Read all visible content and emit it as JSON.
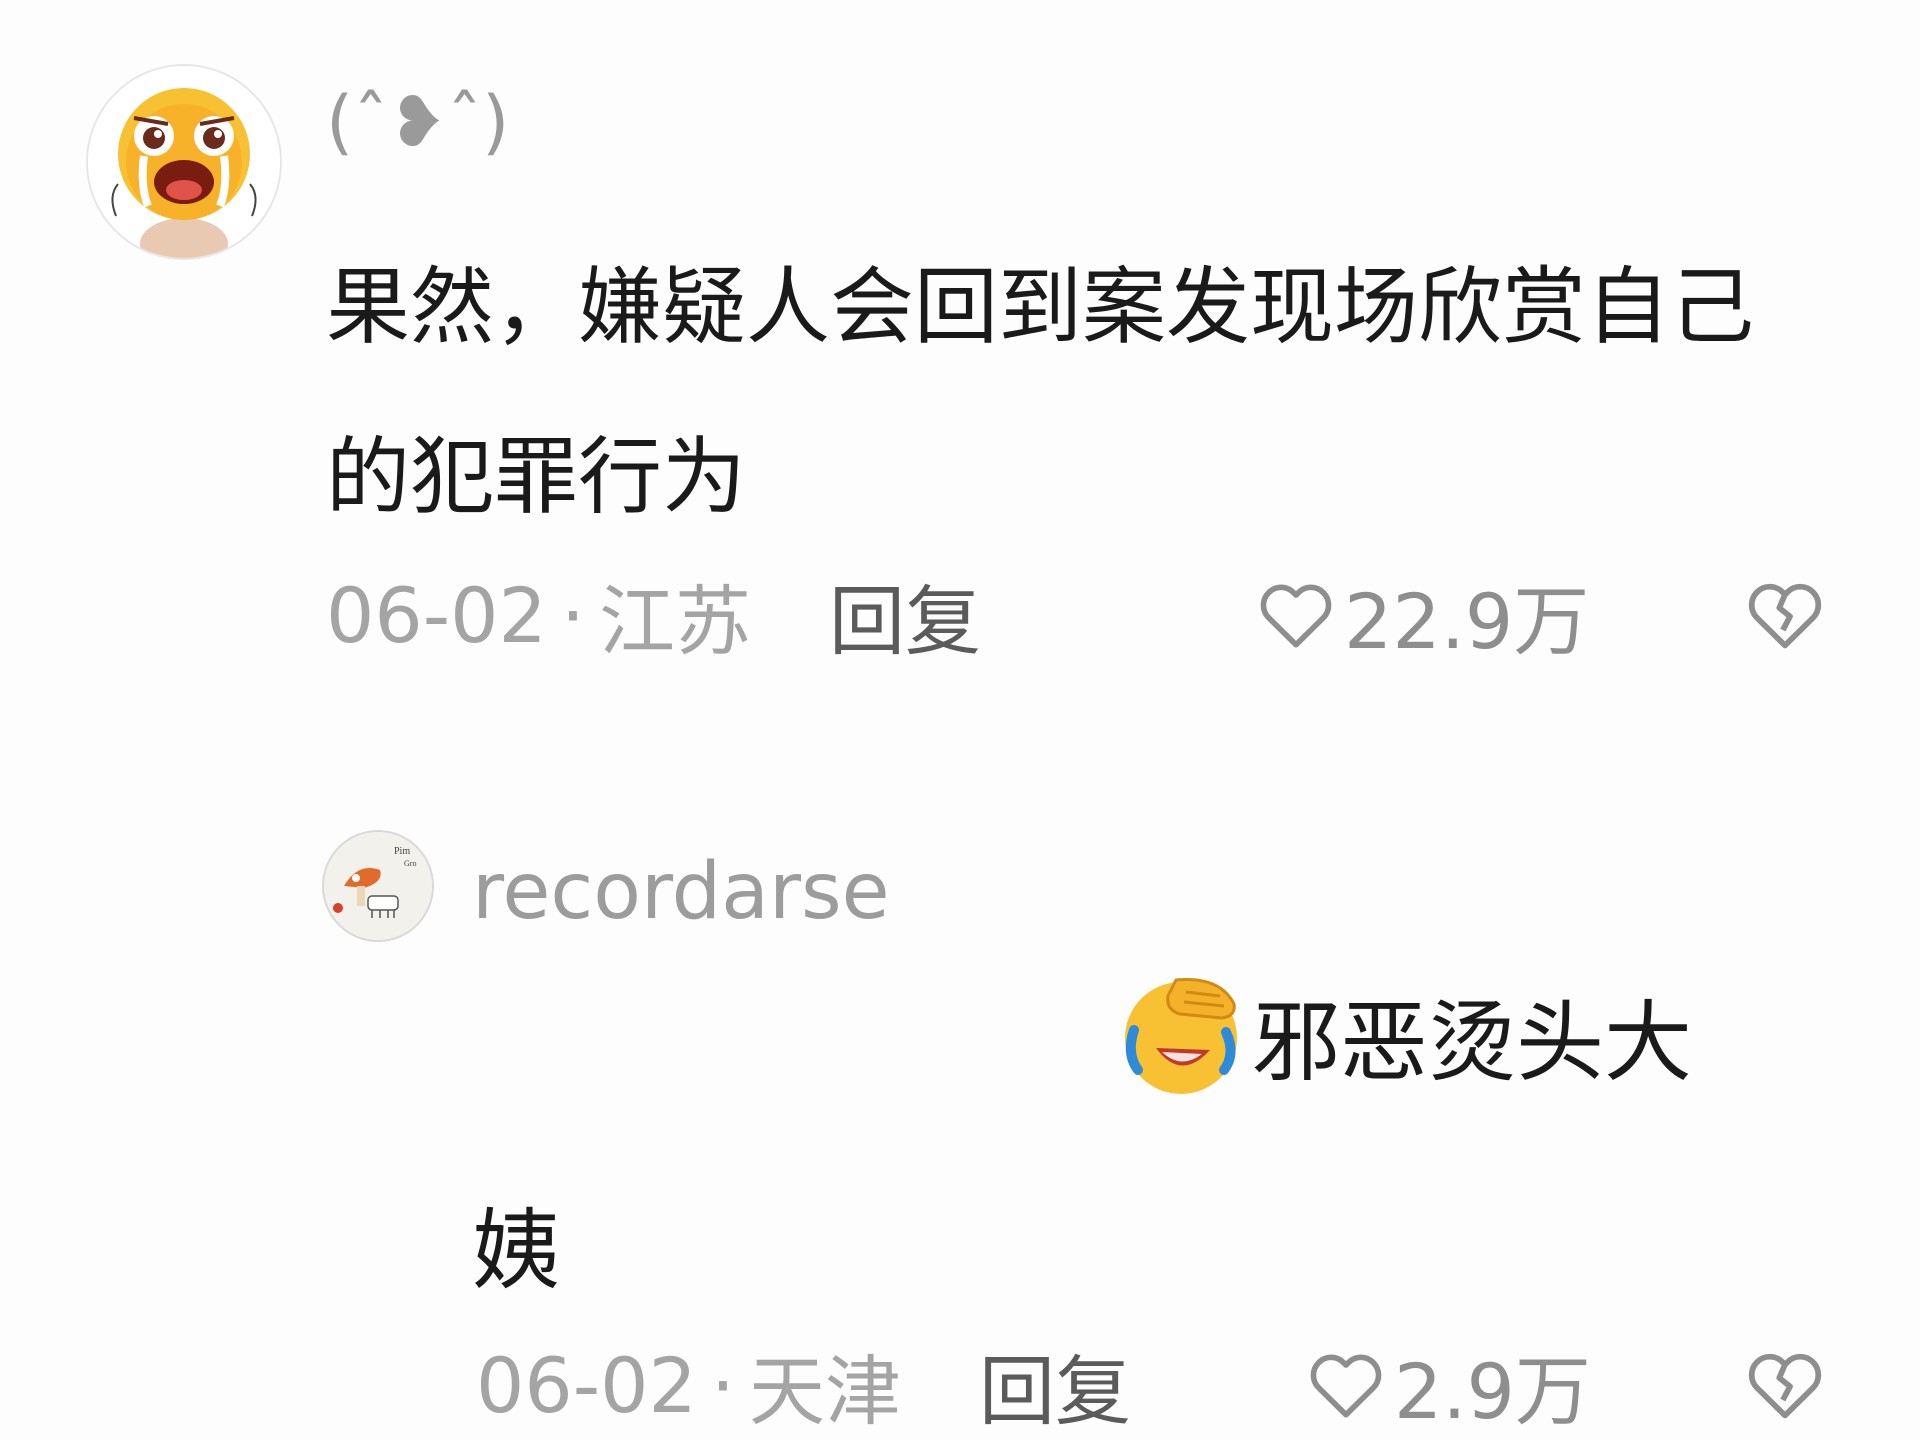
{
  "comment": {
    "username": "(ˆ❥ˆ)",
    "text": "果然，嫌疑人会回到案发现场欣赏自己的犯罪行为",
    "date": "06-02",
    "separator": "·",
    "location": "江苏",
    "reply_label": "回复",
    "likes": "22.9万",
    "icons": [
      "crying-face-avatar",
      "heart-icon",
      "broken-heart-icon"
    ]
  },
  "reply": {
    "username": "recordarse",
    "emoji": "face-palm-laughing-emoji",
    "text_line1": "邪恶烫头大",
    "text_line2": "姨",
    "date": "06-02",
    "separator": "·",
    "location": "天津",
    "reply_label": "回复",
    "likes": "2.9万",
    "icons": [
      "mushroom-avatar",
      "heart-icon",
      "broken-heart-icon"
    ]
  },
  "colors": {
    "background": "#fdfdfd",
    "text_primary": "#1a1a1a",
    "text_secondary": "#a4a4a4",
    "reply_button": "#5b5b5b"
  }
}
